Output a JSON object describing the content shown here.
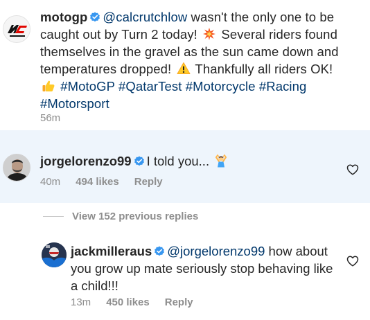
{
  "post": {
    "username": "motogp",
    "mention": "@calcrutchlow",
    "text_1": " wasn't the only one to be caught out by Turn 2 today! ",
    "emoji_1": "collision-emoji",
    "text_2": " Several riders found themselves in the gravel as the sun came down and temperatures dropped! ",
    "emoji_2": "warning-emoji",
    "text_3": " Thankfully all riders OK! ",
    "emoji_3": "thumbs-up-emoji",
    "hashtags": [
      "#MotoGP",
      "#QatarTest",
      "#Motorcycle",
      "#Racing",
      "#Motorsport"
    ],
    "time": "56m"
  },
  "comment": {
    "username": "jorgelorenzo99",
    "text": "I told you...",
    "emoji": "person-shrugging-emoji",
    "time": "40m",
    "likes": "494 likes",
    "reply_label": "Reply"
  },
  "view_replies": "View 152 previous replies",
  "reply": {
    "username": "jackmilleraus",
    "mention": "@jorgelorenzo99",
    "text": " how about you grow up mate seriously stop behaving like a child!!!",
    "time": "13m",
    "likes": "450 likes",
    "reply_label": "Reply"
  },
  "colors": {
    "text": "#262626",
    "muted": "#8e8e8e",
    "link": "#00376b",
    "verified": "#3897f0",
    "highlight_bg": "#eef5fc"
  },
  "icons": [
    "verified-badge-icon",
    "heart-icon",
    "motogp-logo"
  ]
}
